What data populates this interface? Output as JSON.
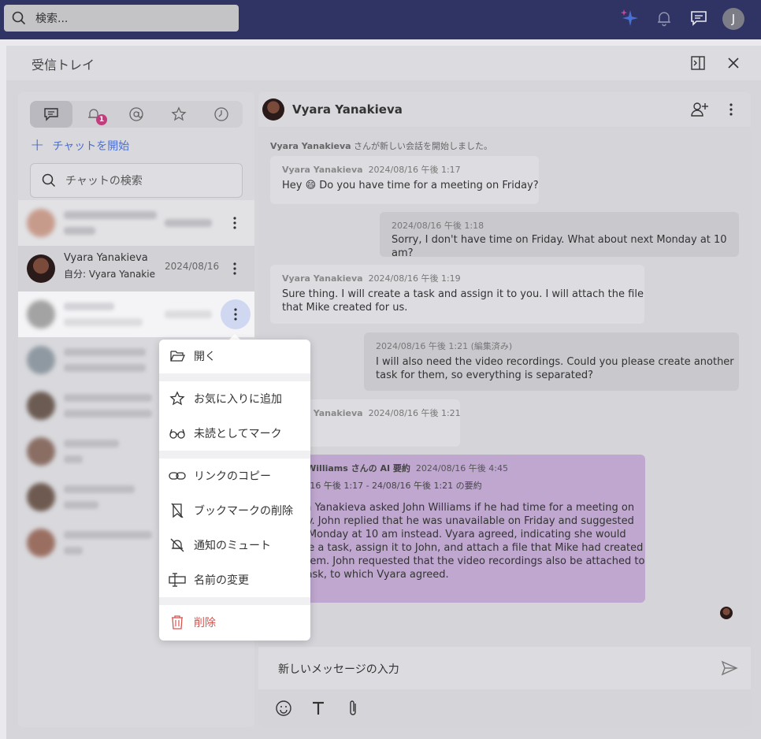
{
  "topbar": {
    "search_placeholder": "検索...",
    "avatar_initial": "J"
  },
  "panel": {
    "title": "受信トレイ"
  },
  "chat_list": {
    "tabs": [
      "chats-icon",
      "notifications-icon",
      "mentions-icon",
      "favorites-icon",
      "history-icon"
    ],
    "notification_badge": "1",
    "start_chat_label": "チャットを開始",
    "search_placeholder": "チャットの検索",
    "selected_chat": {
      "name": "Vyara Yanakieva",
      "preview": "自分: Vyara Yanakieva...",
      "date": "2024/08/16"
    }
  },
  "conversation": {
    "title": "Vyara Yanakieva",
    "started_name": "Vyara Yanakieva",
    "started_text": " さんが新しい会話を開始しました。",
    "messages": [
      {
        "sender": "Vyara Yanakieva",
        "time": "2024/08/16 午後 1:17",
        "text": "Hey 😄 Do you have time for a meeting on Friday?"
      },
      {
        "sender": "",
        "time": "2024/08/16 午後 1:18",
        "text": "Sorry, I don't have time on Friday. What about next Monday at 10 am?"
      },
      {
        "sender": "Vyara Yanakieva",
        "time": "2024/08/16 午後 1:19",
        "text1": "Sure thing. I will create a task and assign it to you. I will attach the file",
        "text2": "that Mike created for us."
      },
      {
        "sender": "",
        "time": "2024/08/16 午後 1:21 (編集済み)",
        "text1": "I will also need the video recordings. Could you please create another",
        "text2": "task for them, so everything is separated?"
      },
      {
        "sender": "Vyara Yanakieva",
        "time": "2024/08/16 午後 1:21",
        "text": "😄"
      }
    ],
    "ai_summary": {
      "header": "John Williams さんの AI 要約",
      "time": "2024/08/16 午後 4:45",
      "range": "24/08/16 午後 1:17 - 24/08/16 午後 1:21 の要約",
      "lines": [
        "Vyara Yanakieva asked John Williams if he had time for a meeting on",
        "Friday. John replied that he was unavailable on Friday and suggested",
        "next Monday at 10 am instead. Vyara agreed, indicating she would",
        "create a task, assign it to John, and attach a file that Mike had created",
        "for them. John requested that the video recordings also be attached to",
        "the task, to which Vyara agreed."
      ]
    },
    "composer_placeholder": "新しいメッセージの入力"
  },
  "context_menu": {
    "open": "開く",
    "add_favorite": "お気に入りに追加",
    "mark_unread": "未読としてマーク",
    "copy_link": "リンクのコピー",
    "remove_bookmark": "ブックマークの削除",
    "mute": "通知のミュート",
    "rename": "名前の変更",
    "delete": "削除"
  },
  "colors": {
    "topbar": "#2f3465",
    "accent": "#4a6ed1",
    "badge": "#bf3f7c",
    "ai_bubble": "#bfa7cf",
    "danger": "#d9534f"
  }
}
